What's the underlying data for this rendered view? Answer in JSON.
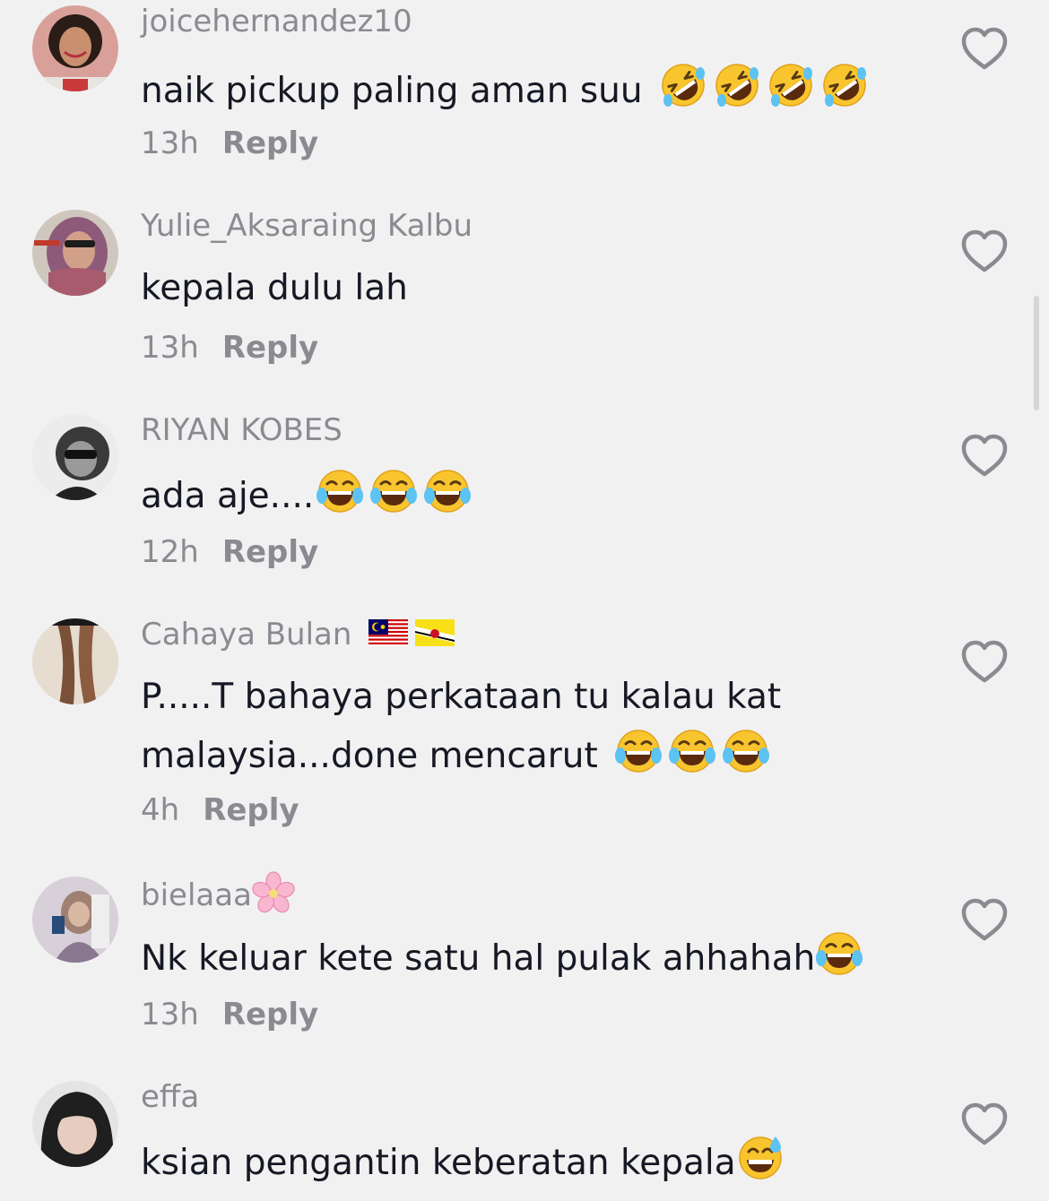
{
  "colors": {
    "background": "#f1f1f2",
    "username": "#8a8b91",
    "comment_text": "#161823",
    "meta": "#8a8b91",
    "like_icon": "#8a8b91"
  },
  "icons": {
    "like": "heart-outline-icon",
    "rofl_emoji": "rolling-on-floor-laughing-emoji",
    "joy_emoji": "face-with-tears-of-joy-emoji",
    "sweat_smile_emoji": "grinning-face-with-sweat-emoji",
    "blossom_emoji": "cherry-blossom-emoji",
    "flag_my": "malaysia-flag-icon",
    "flag_bn": "brunei-flag-icon"
  },
  "comments": [
    {
      "username": "joicehernandez10",
      "text": "naik pickup paling aman suu",
      "emojis": [
        "rofl",
        "rofl",
        "rofl",
        "rofl"
      ],
      "time": "13h",
      "reply": "Reply"
    },
    {
      "username": "Yulie_Aksaraing Kalbu",
      "text": "kepala dulu lah",
      "emojis": [],
      "time": "13h",
      "reply": "Reply"
    },
    {
      "username": "RIYAN KOBES",
      "text": "ada aje....",
      "emojis": [
        "joy",
        "joy",
        "joy"
      ],
      "time": "12h",
      "reply": "Reply"
    },
    {
      "username": "Cahaya Bulan",
      "username_flags": [
        "MY",
        "BN"
      ],
      "text_line1": "P.....T bahaya perkataan tu kalau kat",
      "text_line2": "malaysia...done mencarut",
      "emojis": [
        "joy",
        "joy",
        "joy"
      ],
      "time": "4h",
      "reply": "Reply"
    },
    {
      "username": "bielaaa",
      "username_emoji": "blossom",
      "text": "Nk keluar kete satu hal pulak ahhahah",
      "emojis": [
        "joy"
      ],
      "time": "13h",
      "reply": "Reply"
    },
    {
      "username": "effa",
      "text": "ksian pengantin keberatan kepala",
      "emojis": [
        "sweat_smile"
      ],
      "time": "",
      "reply": ""
    }
  ]
}
